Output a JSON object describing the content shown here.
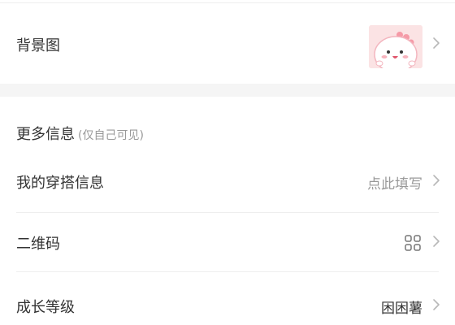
{
  "background_row": {
    "label": "背景图",
    "thumbnail_icon": "pink-dinosaur-sticker"
  },
  "more_info": {
    "title": "更多信息",
    "subtitle": "(仅自己可见)"
  },
  "outfit_row": {
    "label": "我的穿搭信息",
    "value": "点此填写"
  },
  "qr_row": {
    "label": "二维码",
    "icon": "qr-grid-icon"
  },
  "level_row": {
    "label": "成长等级",
    "value": "困困薯"
  },
  "colors": {
    "page_bg": "#f5f5f5",
    "card_bg": "#ffffff",
    "primary_text": "#333333",
    "secondary_text": "#999999",
    "divider": "#eeeeee"
  }
}
